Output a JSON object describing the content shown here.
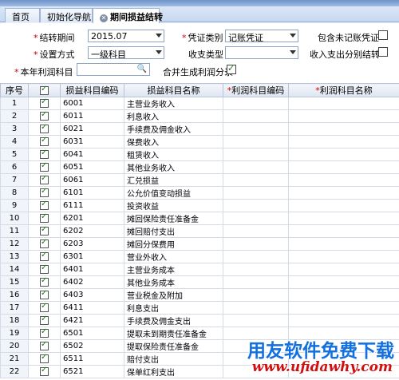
{
  "tabs": [
    {
      "label": "首页",
      "active": false
    },
    {
      "label": "初始化导航",
      "active": false
    },
    {
      "label": "期间损益结转",
      "active": true
    }
  ],
  "form": {
    "period_label": "结转期间",
    "period_value": "2015.07",
    "method_label": "设置方式",
    "method_value": "一级科目",
    "profit_account_label": "本年利润科目",
    "profit_account_value": "",
    "voucher_type_label": "凭证类别",
    "voucher_type_value": "记账凭证",
    "revenue_type_label": "收支类型",
    "revenue_type_value": "",
    "merge_label": "合并生成利润分录",
    "merge_checked": true,
    "include_unposted_label": "包含未记账凭证",
    "include_unposted_checked": false,
    "separate_label": "收入支出分别结转",
    "separate_checked": false
  },
  "grid": {
    "headers": {
      "seq": "序号",
      "code": "损益科目编码",
      "name": "损益科目名称",
      "profit_code": "利润科目编码",
      "profit_name": "利润科目名称"
    },
    "rows": [
      {
        "seq": "1",
        "code": "6001",
        "name": "主营业务收入"
      },
      {
        "seq": "2",
        "code": "6011",
        "name": "利息收入"
      },
      {
        "seq": "3",
        "code": "6021",
        "name": "手续费及佣金收入"
      },
      {
        "seq": "4",
        "code": "6031",
        "name": "保费收入"
      },
      {
        "seq": "5",
        "code": "6041",
        "name": "租赁收入"
      },
      {
        "seq": "6",
        "code": "6051",
        "name": "其他业务收入"
      },
      {
        "seq": "7",
        "code": "6061",
        "name": "汇兑损益"
      },
      {
        "seq": "8",
        "code": "6101",
        "name": "公允价值变动损益"
      },
      {
        "seq": "9",
        "code": "6111",
        "name": "投资收益"
      },
      {
        "seq": "10",
        "code": "6201",
        "name": "摊回保险责任准备金"
      },
      {
        "seq": "11",
        "code": "6202",
        "name": "摊回赔付支出"
      },
      {
        "seq": "12",
        "code": "6203",
        "name": "摊回分保费用"
      },
      {
        "seq": "13",
        "code": "6301",
        "name": "营业外收入"
      },
      {
        "seq": "14",
        "code": "6401",
        "name": "主营业务成本"
      },
      {
        "seq": "15",
        "code": "6402",
        "name": "其他业务成本"
      },
      {
        "seq": "16",
        "code": "6403",
        "name": "营业税金及附加"
      },
      {
        "seq": "17",
        "code": "6411",
        "name": "利息支出"
      },
      {
        "seq": "18",
        "code": "6421",
        "name": "手续费及佣金支出"
      },
      {
        "seq": "19",
        "code": "6501",
        "name": "提取未到期责任准备金"
      },
      {
        "seq": "20",
        "code": "6502",
        "name": "提取保险责任准备金"
      },
      {
        "seq": "21",
        "code": "6511",
        "name": "赔付支出"
      },
      {
        "seq": "22",
        "code": "6521",
        "name": "保单红利支出"
      }
    ]
  },
  "watermark": {
    "title": "用友软件免费下载",
    "url": "www.ufidawhy.com"
  }
}
